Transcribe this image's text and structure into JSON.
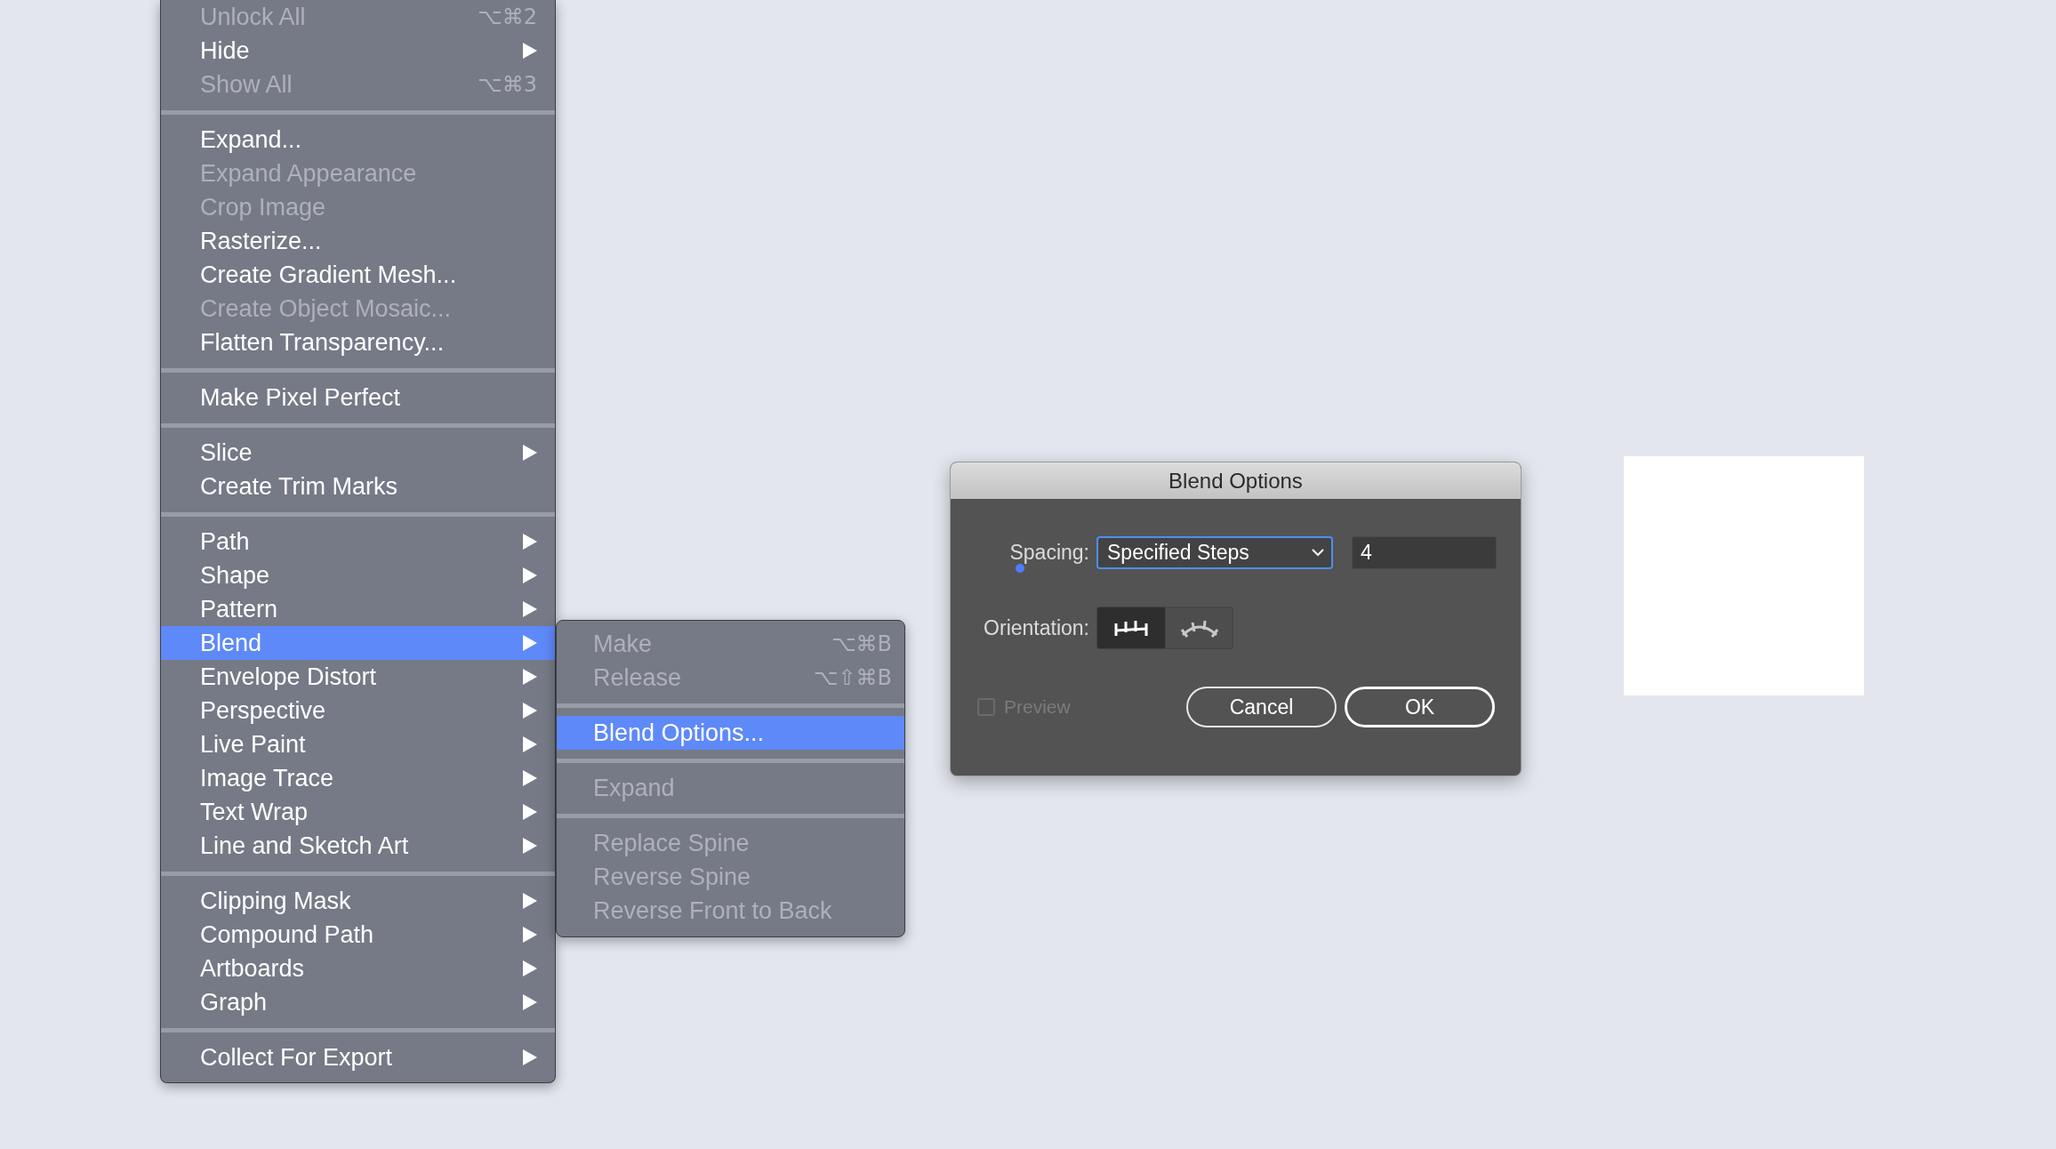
{
  "menu": {
    "groups": [
      {
        "items": [
          {
            "label": "Unlock All",
            "disabled": true,
            "shortcut": "⌥⌘2",
            "has_submenu": false,
            "selected": false
          },
          {
            "label": "Hide",
            "disabled": false,
            "has_submenu": true,
            "selected": false
          },
          {
            "label": "Show All",
            "disabled": true,
            "shortcut": "⌥⌘3",
            "has_submenu": false,
            "selected": false
          }
        ]
      },
      {
        "items": [
          {
            "label": "Expand...",
            "disabled": false,
            "has_submenu": false,
            "selected": false
          },
          {
            "label": "Expand Appearance",
            "disabled": true,
            "has_submenu": false,
            "selected": false
          },
          {
            "label": "Crop Image",
            "disabled": true,
            "has_submenu": false,
            "selected": false
          },
          {
            "label": "Rasterize...",
            "disabled": false,
            "has_submenu": false,
            "selected": false
          },
          {
            "label": "Create Gradient Mesh...",
            "disabled": false,
            "has_submenu": false,
            "selected": false
          },
          {
            "label": "Create Object Mosaic...",
            "disabled": true,
            "has_submenu": false,
            "selected": false
          },
          {
            "label": "Flatten Transparency...",
            "disabled": false,
            "has_submenu": false,
            "selected": false
          }
        ]
      },
      {
        "items": [
          {
            "label": "Make Pixel Perfect",
            "disabled": false,
            "has_submenu": false,
            "selected": false
          }
        ]
      },
      {
        "items": [
          {
            "label": "Slice",
            "disabled": false,
            "has_submenu": true,
            "selected": false
          },
          {
            "label": "Create Trim Marks",
            "disabled": false,
            "has_submenu": false,
            "selected": false
          }
        ]
      },
      {
        "items": [
          {
            "label": "Path",
            "disabled": false,
            "has_submenu": true,
            "selected": false
          },
          {
            "label": "Shape",
            "disabled": false,
            "has_submenu": true,
            "selected": false
          },
          {
            "label": "Pattern",
            "disabled": false,
            "has_submenu": true,
            "selected": false
          },
          {
            "label": "Blend",
            "disabled": false,
            "has_submenu": true,
            "selected": true
          },
          {
            "label": "Envelope Distort",
            "disabled": false,
            "has_submenu": true,
            "selected": false
          },
          {
            "label": "Perspective",
            "disabled": false,
            "has_submenu": true,
            "selected": false
          },
          {
            "label": "Live Paint",
            "disabled": false,
            "has_submenu": true,
            "selected": false
          },
          {
            "label": "Image Trace",
            "disabled": false,
            "has_submenu": true,
            "selected": false
          },
          {
            "label": "Text Wrap",
            "disabled": false,
            "has_submenu": true,
            "selected": false
          },
          {
            "label": "Line and Sketch Art",
            "disabled": false,
            "has_submenu": true,
            "selected": false
          }
        ]
      },
      {
        "items": [
          {
            "label": "Clipping Mask",
            "disabled": false,
            "has_submenu": true,
            "selected": false
          },
          {
            "label": "Compound Path",
            "disabled": false,
            "has_submenu": true,
            "selected": false
          },
          {
            "label": "Artboards",
            "disabled": false,
            "has_submenu": true,
            "selected": false
          },
          {
            "label": "Graph",
            "disabled": false,
            "has_submenu": true,
            "selected": false
          }
        ]
      },
      {
        "items": [
          {
            "label": "Collect For Export",
            "disabled": false,
            "has_submenu": true,
            "selected": false
          }
        ]
      }
    ]
  },
  "submenu": {
    "groups": [
      {
        "items": [
          {
            "label": "Make",
            "disabled": true,
            "shortcut": "⌥⌘B",
            "has_submenu": false,
            "selected": false
          },
          {
            "label": "Release",
            "disabled": true,
            "shortcut": "⌥⇧⌘B",
            "has_submenu": false,
            "selected": false
          }
        ]
      },
      {
        "items": [
          {
            "label": "Blend Options...",
            "disabled": false,
            "has_submenu": false,
            "selected": true
          }
        ]
      },
      {
        "items": [
          {
            "label": "Expand",
            "disabled": true,
            "has_submenu": false,
            "selected": false
          }
        ]
      },
      {
        "items": [
          {
            "label": "Replace Spine",
            "disabled": true,
            "has_submenu": false,
            "selected": false
          },
          {
            "label": "Reverse Spine",
            "disabled": true,
            "has_submenu": false,
            "selected": false
          },
          {
            "label": "Reverse Front to Back",
            "disabled": true,
            "has_submenu": false,
            "selected": false
          }
        ]
      }
    ]
  },
  "dialog": {
    "title": "Blend Options",
    "spacing": {
      "label": "Spacing:",
      "value": "Specified Steps",
      "steps": "4"
    },
    "orientation": {
      "label": "Orientation:",
      "options": [
        {
          "kind": "page",
          "selected": true
        },
        {
          "kind": "path",
          "selected": false
        }
      ]
    },
    "preview": {
      "label": "Preview",
      "checked": false,
      "disabled": true
    },
    "buttons": [
      {
        "label": "Cancel",
        "default": false
      },
      {
        "label": "OK",
        "default": true
      }
    ]
  }
}
